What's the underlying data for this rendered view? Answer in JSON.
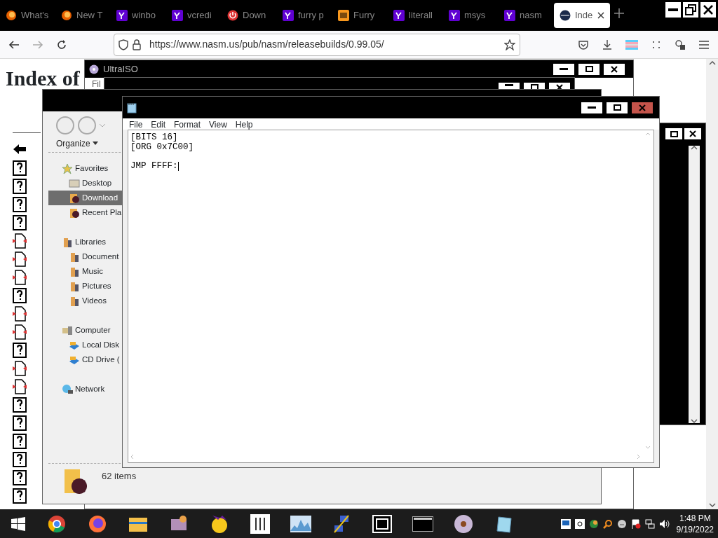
{
  "browser": {
    "tabs": [
      {
        "label": "What's",
        "selected": false
      },
      {
        "label": "New T",
        "selected": false
      },
      {
        "label": "winbo",
        "selected": false
      },
      {
        "label": "vcredi",
        "selected": false
      },
      {
        "label": "Down",
        "selected": false
      },
      {
        "label": "furry p",
        "selected": false
      },
      {
        "label": "Furry",
        "selected": false
      },
      {
        "label": "literall",
        "selected": false
      },
      {
        "label": "msys",
        "selected": false
      },
      {
        "label": "nasm",
        "selected": false
      },
      {
        "label": "Inde",
        "selected": true
      }
    ],
    "url": "https://www.nasm.us/pub/nasm/releasebuilds/0.99.05/"
  },
  "page": {
    "heading": "Index of",
    "rows": [
      {
        "kind": "back"
      },
      {
        "kind": "unknown"
      },
      {
        "kind": "unknown"
      },
      {
        "kind": "unknown"
      },
      {
        "kind": "unknown"
      },
      {
        "kind": "binary"
      },
      {
        "kind": "binary"
      },
      {
        "kind": "binary"
      },
      {
        "kind": "unknown"
      },
      {
        "kind": "binary"
      },
      {
        "kind": "binary"
      },
      {
        "kind": "unknown"
      },
      {
        "kind": "binary"
      },
      {
        "kind": "binary"
      },
      {
        "kind": "unknown"
      },
      {
        "kind": "unknown"
      },
      {
        "kind": "unknown"
      },
      {
        "kind": "unknown"
      },
      {
        "kind": "unknown"
      },
      {
        "kind": "unknown"
      }
    ]
  },
  "ultraiso": {
    "title": "UltraISO",
    "menu": "Fil"
  },
  "explorer": {
    "organize": "Organize",
    "nav": [
      {
        "label": "Favorites",
        "children": [
          {
            "label": "Desktop",
            "selected": false
          },
          {
            "label": "Download",
            "selected": true
          },
          {
            "label": "Recent Pla",
            "selected": false
          }
        ]
      },
      {
        "label": "Libraries",
        "children": [
          {
            "label": "Document",
            "selected": false
          },
          {
            "label": "Music",
            "selected": false
          },
          {
            "label": "Pictures",
            "selected": false
          },
          {
            "label": "Videos",
            "selected": false
          }
        ]
      },
      {
        "label": "Computer",
        "children": [
          {
            "label": "Local Disk",
            "selected": false
          },
          {
            "label": "CD Drive (",
            "selected": false
          }
        ]
      },
      {
        "label": "Network"
      }
    ],
    "status": "62 items"
  },
  "notepad": {
    "menu": [
      "File",
      "Edit",
      "Format",
      "View",
      "Help"
    ],
    "text": "[BITS 16]\n[ORG 0x7C00]\n\nJMP FFFF:"
  },
  "taskbar": {
    "time": "1:48 PM",
    "date": "9/19/2022"
  }
}
